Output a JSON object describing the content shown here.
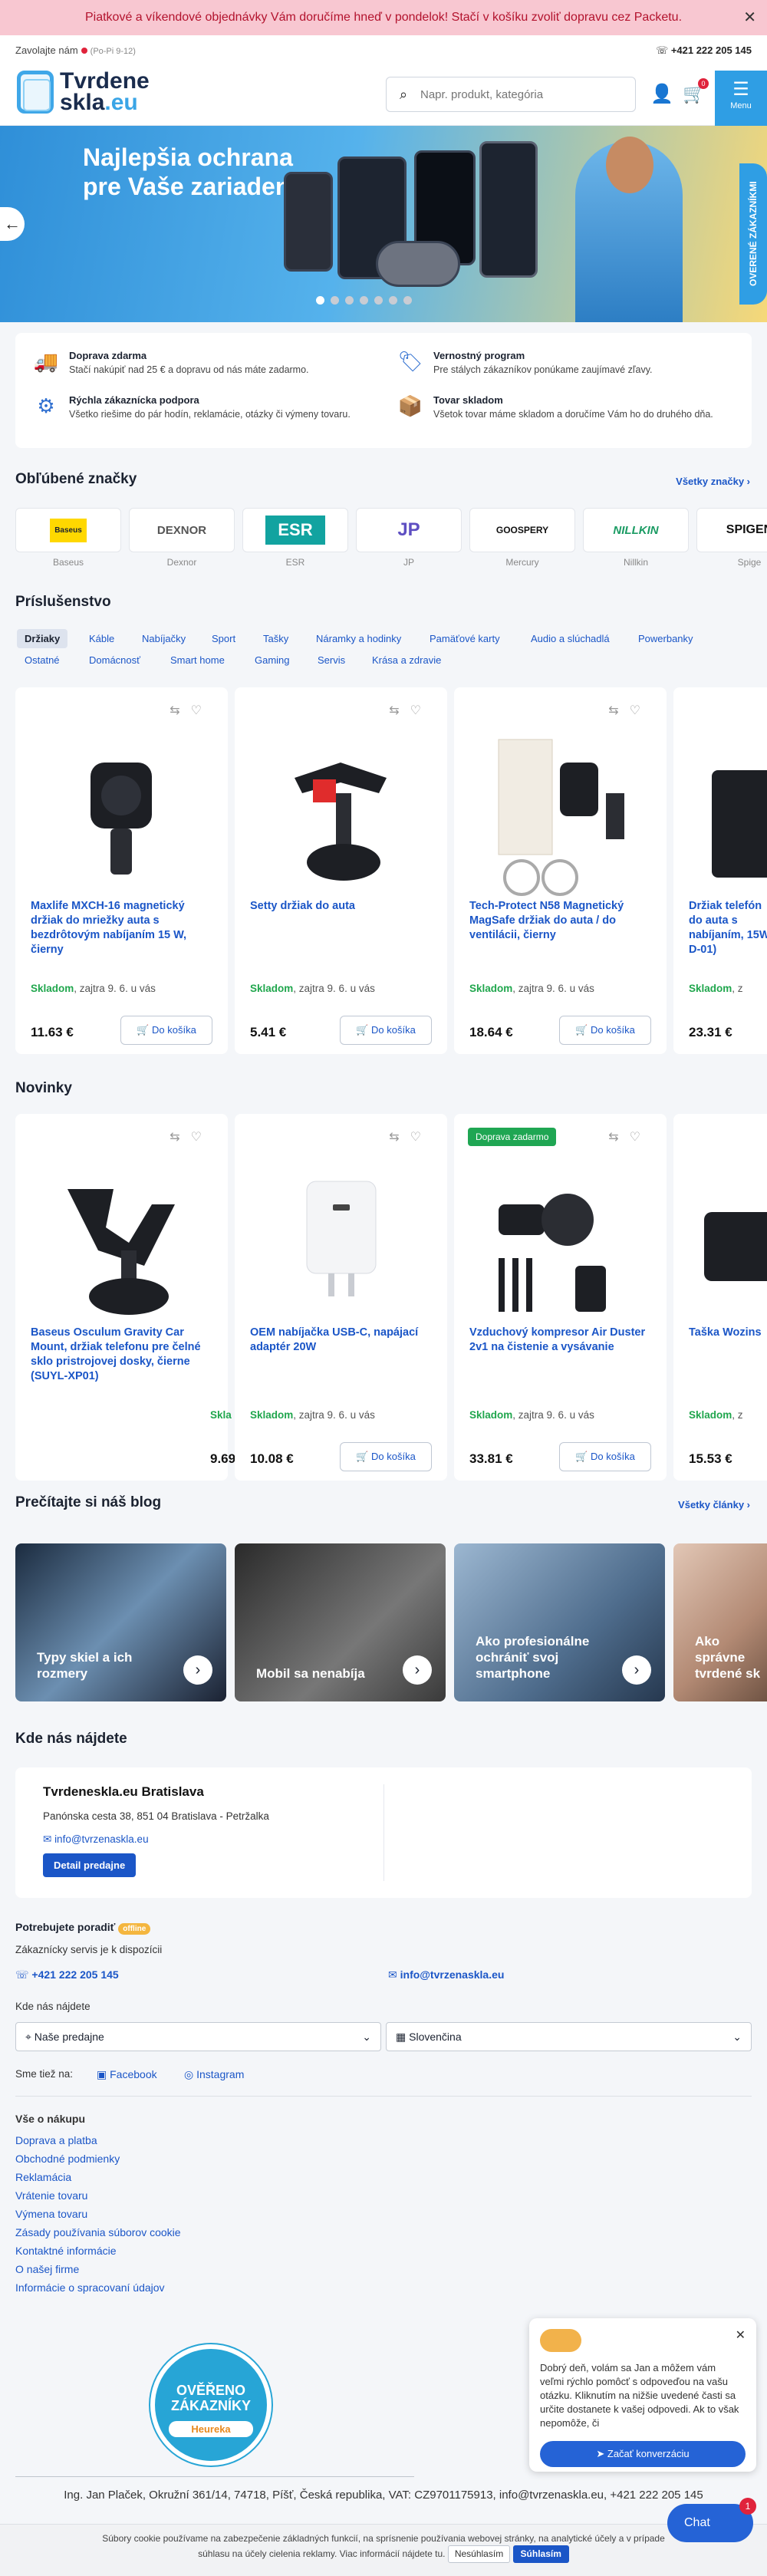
{
  "banner": {
    "text": "Piatkové a víkendové objednávky Vám doručíme hneď v pondelok! Stačí v košíku zvoliť dopravu cez Packetu."
  },
  "header": {
    "call_label": "Zavolajte nám",
    "hours": "(Po-Pi 9-12)",
    "phone": "+421 222 205 145",
    "logo_line1": "Tvrdene",
    "logo_line2a": "skla",
    "logo_line2b": ".eu",
    "search_placeholder": "Napr. produkt, kategória",
    "cart_count": "0",
    "menu_label": "Menu"
  },
  "hero": {
    "title_line1": "Najlepšia ochrana",
    "title_line2": "pre Vaše zariadenie",
    "side_badge": "OVERENÉ ZÁKAZNÍKMI"
  },
  "benefits": [
    {
      "title": "Doprava zdarma",
      "desc": "Stačí nakúpiť nad 25 € a dopravu od nás máte zadarmo."
    },
    {
      "title": "Vernostný program",
      "desc": "Pre stálych zákazníkov ponúkame zaujímavé zľavy."
    },
    {
      "title": "Rýchla zákaznícka podpora",
      "desc": "Všetko riešime do pár hodín, reklamácie, otázky či výmeny tovaru."
    },
    {
      "title": "Tovar skladom",
      "desc": "Všetok tovar máme skladom a doručíme Vám ho do druhého dňa."
    }
  ],
  "brands": {
    "title": "Obľúbené značky",
    "link": "Všetky značky ›",
    "items": [
      {
        "logo": "Baseus",
        "name": "Baseus"
      },
      {
        "logo": "DEXNOR",
        "name": "Dexnor"
      },
      {
        "logo": "ESR",
        "name": "ESR"
      },
      {
        "logo": "JP",
        "name": "JP"
      },
      {
        "logo": "GOOSPERY",
        "name": "Mercury"
      },
      {
        "logo": "NILLKIN",
        "name": "Nillkin"
      },
      {
        "logo": "SPIGEN",
        "name": "Spige"
      }
    ]
  },
  "accessories": {
    "title": "Príslušenstvo",
    "chips_row1": [
      "Držiaky",
      "Káble",
      "Nabíjačky",
      "Sport",
      "Tašky",
      "Náramky a hodinky",
      "Pamäťové karty",
      "Audio a slúchadlá",
      "Powerbanky"
    ],
    "chips_row2": [
      "Ostatné",
      "Domácnosť",
      "Smart home",
      "Gaming",
      "Servis",
      "Krása a zdravie"
    ],
    "products": [
      {
        "name": "Maxlife MXCH-16 magnetický držiak do mriežky auta s bezdrôtovým nabíjaním 15 W, čierny",
        "stock": "Skladom",
        "delivery": ", zajtra 9. 6. u vás",
        "price": "11.63 €",
        "cta": "Do košíka"
      },
      {
        "name": "Setty držiak do auta",
        "stock": "Skladom",
        "delivery": ", zajtra 9. 6. u vás",
        "price": "5.41 €",
        "cta": "Do košíka"
      },
      {
        "name": "Tech-Protect N58 Magnetický MagSafe držiak do auta / do ventilácii, čierny",
        "stock": "Skladom",
        "delivery": ", zajtra 9. 6. u vás",
        "price": "18.64 €",
        "cta": "Do košíka"
      },
      {
        "name": "Držiak telefón do auta s nabíjaním, 15W D-01)",
        "stock": "Skladom",
        "delivery": ", z",
        "price": "23.31 €",
        "cta": ""
      }
    ]
  },
  "news": {
    "title": "Novinky",
    "products": [
      {
        "tag": "",
        "name": "Baseus Osculum Gravity Car Mount, držiak telefonu pre čelné sklo pristrojovej dosky, čierne (SUYL-XP01)",
        "stock": "Skla",
        "delivery": "",
        "price": "9.69",
        "cta": ""
      },
      {
        "tag": "",
        "name": "OEM nabíjačka USB-C, napájací adaptér 20W",
        "stock": "Skladom",
        "delivery": ", zajtra 9. 6. u vás",
        "price": "10.08 €",
        "cta": "Do košíka"
      },
      {
        "tag": "Doprava zadarmo",
        "name": "Vzduchový kompresor Air Duster 2v1 na čistenie a vysávanie",
        "stock": "Skladom",
        "delivery": ", zajtra 9. 6. u vás",
        "price": "33.81 €",
        "cta": "Do košíka"
      },
      {
        "tag": "",
        "name": "Taška Wozins",
        "stock": "Skladom",
        "delivery": ", z",
        "price": "15.53 €",
        "cta": ""
      }
    ]
  },
  "blog": {
    "title": "Prečítajte si náš blog",
    "link": "Všetky články ›",
    "posts": [
      "Typy skiel a ich rozmery",
      "Mobil sa nenabíja",
      "Ako profesionálne ochrániť svoj smartphone",
      "Ako správne tvrdené sk"
    ]
  },
  "store": {
    "section_title": "Kde nás nájdete",
    "name": "Tvrdeneskla.eu Bratislava",
    "address": "Panónska cesta 38, 851 04 Bratislava - Petržalka",
    "email": "info@tvrzenaskla.eu",
    "button": "Detail predajne"
  },
  "help": {
    "title": "Potrebujete poradiť",
    "status": "offline",
    "sub": "Zákaznícky servis je k dispozícii",
    "phone": "+421 222 205 145",
    "email": "info@tvrzenaskla.eu",
    "where_label": "Kde nás nájdete",
    "store_select": "Naše predajne",
    "country_select": "Slovenčina",
    "social_label": "Sme tiež na:",
    "facebook": "Facebook",
    "instagram": "Instagram"
  },
  "footer": {
    "title": "Vše o nákupu",
    "links": [
      "Doprava a platba",
      "Obchodné podmienky",
      "Reklamácia",
      "Vrátenie tovaru",
      "Výmena tovaru",
      "Zásady používania súborov cookie",
      "Kontaktné informácie",
      "O našej firme",
      "Informácie o spracovaní údajov"
    ],
    "heureka_l1": "OVĚŘENO",
    "heureka_l2": "ZÁKAZNÍKY",
    "heureka_brand": "Heureka",
    "legal": "Ing. Jan Plaček, Okružní 361/14, 74718, Píšť, Česká republika, VAT: CZ9701175913, info@tvrzenaskla.eu, +421 222 205 145"
  },
  "chat": {
    "message": "Dobrý deň, volám sa Jan a môžem vám veľmi rýchlo pomôcť s odpoveďou na vašu otázku. Kliknutím na nižšie uvedené časti sa určite dostanete k vašej odpovedi. Ak to však nepomôže, či",
    "cta": "Začať konverzáciu",
    "fab": "Chat",
    "fab_count": "1"
  },
  "cookie": {
    "line1": "Súbory cookie používame na zabezpečenie základných funkcií, na sprísnenie používania webovej stránky, na analytické účely a v prípade",
    "line2": "súhlasu na účely cielenia reklamy. Viac informácií nájdete tu.",
    "decline": "Nesúhlasím",
    "accept": "Súhlasím"
  }
}
